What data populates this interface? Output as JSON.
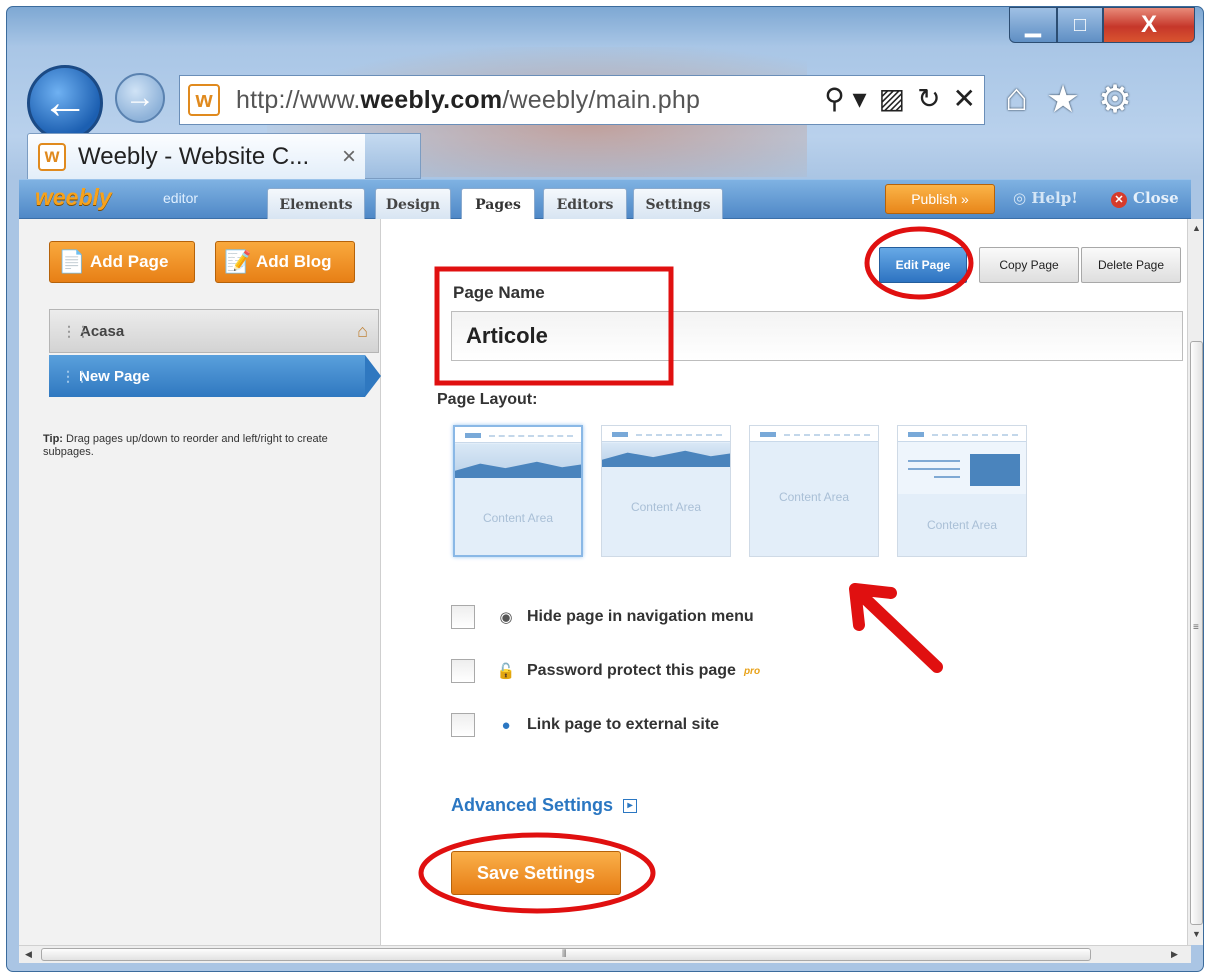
{
  "browser": {
    "url_prefix": "http://www.",
    "url_domain": "weebly.com",
    "url_path": "/weebly/main.php",
    "favicon": "w",
    "tab_title": "Weebly - Website C...",
    "tab_close": "×",
    "back_icon": "arrow-left-icon",
    "forward_icon": "arrow-right-icon",
    "addr_icons": [
      "⚲ ▾",
      "▨",
      "↻",
      "✕"
    ],
    "tools_icons": [
      "⌂",
      "★",
      "⚙"
    ],
    "window_min": "▁",
    "window_max": "□",
    "window_close": "X"
  },
  "editor": {
    "logo": "weebly",
    "logo_sub": "editor",
    "tabs": [
      "Elements",
      "Design",
      "Pages",
      "Editors",
      "Settings"
    ],
    "active_tab": "Pages",
    "publish": "Publish »",
    "help": "Help!",
    "close": "Close"
  },
  "sidebar": {
    "add_page": "Add Page",
    "add_blog": "Add Blog",
    "pages": [
      "Acasa",
      "New Page"
    ],
    "tip_label": "Tip:",
    "tip_text": "Drag pages up/down to reorder and left/right to create subpages."
  },
  "main": {
    "edit_page": "Edit Page",
    "copy_page": "Copy Page",
    "delete_page": "Delete Page",
    "page_name_label": "Page Name",
    "page_name_value": "Articole",
    "page_layout_label": "Page Layout:",
    "layouts": [
      "Content Area",
      "Content Area",
      "Content Area",
      "Content Area"
    ],
    "options": [
      {
        "icon": "eye-icon",
        "label": "Hide page in navigation menu"
      },
      {
        "icon": "lock-icon",
        "label": "Password protect this page"
      },
      {
        "icon": "globe-icon",
        "label": "Link page to external site"
      }
    ],
    "pro_badge": "pro",
    "advanced_settings": "Advanced Settings",
    "save_settings": "Save Settings"
  },
  "colors": {
    "accent_orange": "#e8861a",
    "accent_blue": "#2f78c0",
    "annotation_red": "#e01010"
  }
}
